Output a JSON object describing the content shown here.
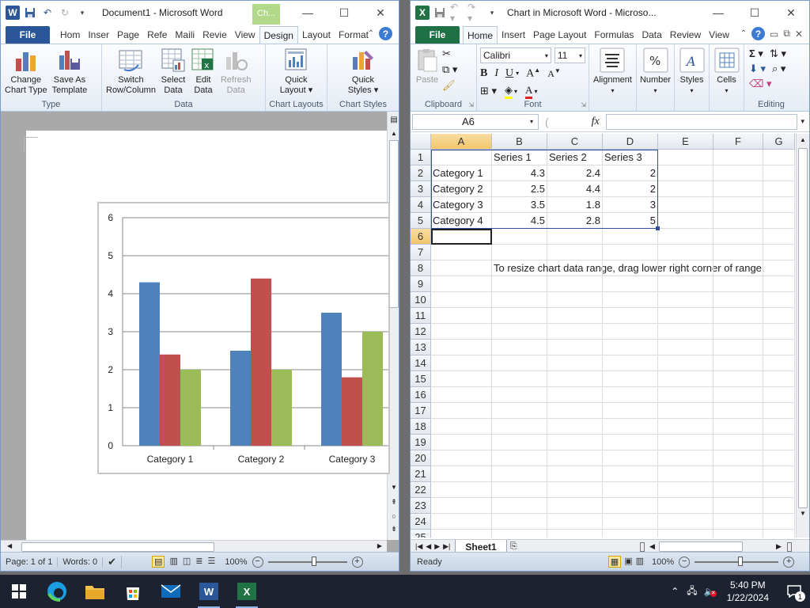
{
  "word": {
    "title": "Document1  -  Microsoft Word",
    "context_tab": "Ch...",
    "tabs": [
      "File",
      "Hom",
      "Inser",
      "Page",
      "Refe",
      "Maili",
      "Revie",
      "View",
      "Design",
      "Layout",
      "Format"
    ],
    "active_tab": "Design",
    "groups": {
      "type": {
        "label": "Type",
        "buttons": [
          "Change\nChart Type",
          "Save As\nTemplate"
        ]
      },
      "data": {
        "label": "Data",
        "buttons": [
          "Switch\nRow/Column",
          "Select\nData",
          "Edit\nData",
          "Refresh\nData"
        ]
      },
      "layouts": {
        "label": "Chart Layouts",
        "button": "Quick\nLayout ▾"
      },
      "styles": {
        "label": "Chart Styles",
        "button": "Quick\nStyles ▾"
      }
    },
    "status": {
      "page": "Page: 1 of 1",
      "words": "Words: 0",
      "zoom": "100%"
    }
  },
  "chart_data": {
    "type": "bar",
    "categories": [
      "Category 1",
      "Category 2",
      "Category 3",
      "Category 4"
    ],
    "visible_categories": 3,
    "series": [
      {
        "name": "Series 1",
        "values": [
          4.3,
          2.5,
          3.5,
          4.5
        ],
        "color": "#4f81bd"
      },
      {
        "name": "Series 2",
        "values": [
          2.4,
          4.4,
          1.8,
          2.8
        ],
        "color": "#c0504d"
      },
      {
        "name": "Series 3",
        "values": [
          2,
          2,
          3,
          5
        ],
        "color": "#9bbb59"
      }
    ],
    "ylim": [
      0,
      6
    ],
    "yticks": [
      "0",
      "1",
      "2",
      "3",
      "4",
      "5",
      "6"
    ],
    "grid": true
  },
  "excel": {
    "title": "Chart in Microsoft Word  -  Microso...",
    "tabs": [
      "File",
      "Home",
      "Insert",
      "Page Layout",
      "Formulas",
      "Data",
      "Review",
      "View"
    ],
    "active_tab": "Home",
    "font_name": "Calibri",
    "font_size": "11",
    "name_box": "A6",
    "fx": "fx",
    "groups": {
      "clipboard": "Clipboard",
      "font": "Font",
      "alignment": "Alignment",
      "number": "Number",
      "styles": "Styles",
      "cells": "Cells",
      "editing": "Editing",
      "paste": "Paste"
    },
    "columns": [
      "A",
      "B",
      "C",
      "D",
      "E",
      "F",
      "G"
    ],
    "rows": [
      "1",
      "2",
      "3",
      "4",
      "5",
      "6",
      "7",
      "8",
      "9",
      "10",
      "11",
      "12",
      "13",
      "14",
      "15",
      "16",
      "17",
      "18",
      "19",
      "20",
      "21",
      "22",
      "23",
      "24",
      "25"
    ],
    "cells": {
      "B1": "Series 1",
      "C1": "Series 2",
      "D1": "Series 3",
      "A2": "Category 1",
      "B2": "4.3",
      "C2": "2.4",
      "D2": "2",
      "A3": "Category 2",
      "B3": "2.5",
      "C3": "4.4",
      "D3": "2",
      "A4": "Category 3",
      "B4": "3.5",
      "C4": "1.8",
      "D4": "3",
      "A5": "Category 4",
      "B5": "4.5",
      "C5": "2.8",
      "D5": "5",
      "B8": "To resize chart data range, drag lower right corner of range."
    },
    "sheet_tab": "Sheet1",
    "status": {
      "ready": "Ready",
      "zoom": "100%"
    }
  },
  "taskbar": {
    "time": "5:40 PM",
    "date": "1/22/2024",
    "notifications": "1"
  },
  "colors": {
    "word_blue": "#2b579a",
    "excel_green": "#217346",
    "accent_file_word": "#2a5699",
    "accent_file_excel": "#1e7145"
  }
}
